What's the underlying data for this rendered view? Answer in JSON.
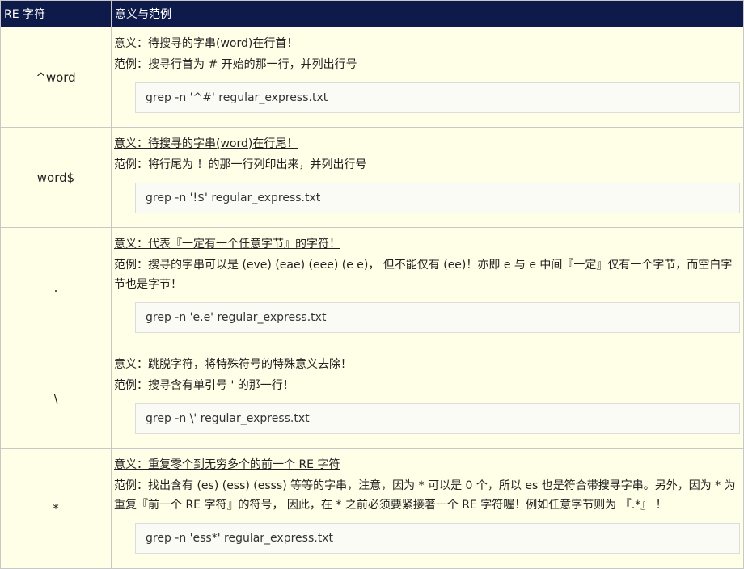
{
  "header": {
    "col_pattern": "RE 字符",
    "col_meaning": "意义与范例"
  },
  "rows": [
    {
      "pattern": "^word",
      "meaning": "意义：待搜寻的字串(word)在行首！",
      "example": "范例：搜寻行首为 # 开始的那一行，并列出行号",
      "code": "grep -n '^#' regular_express.txt"
    },
    {
      "pattern": "word$",
      "meaning": "意义：待搜寻的字串(word)在行尾！",
      "example": "范例：将行尾为 ！的那一行列印出来，并列出行号",
      "code": "grep -n '!$' regular_express.txt"
    },
    {
      "pattern": ".",
      "meaning": "意义：代表『一定有一个任意字节』的字符！",
      "example": "范例：搜寻的字串可以是 (eve) (eae) (eee) (e e)， 但不能仅有 (ee)！亦即 e 与 e 中间『一定』仅有一个字节，而空白字节也是字节！",
      "code": "grep -n 'e.e' regular_express.txt"
    },
    {
      "pattern": "\\",
      "meaning": "意义：跳脱字符，将特殊符号的特殊意义去除！",
      "example": "范例：搜寻含有单引号 ' 的那一行！",
      "code": "grep -n \\' regular_express.txt"
    },
    {
      "pattern": "*",
      "meaning": "意义：重复零个到无穷多个的前一个 RE 字符",
      "example": "范例：找出含有 (es) (ess) (esss) 等等的字串，注意，因为 * 可以是 0 个，所以 es 也是符合带搜寻字串。另外，因为 * 为重复『前一个 RE 字符』的符号， 因此，在 * 之前必须要紧接著一个 RE 字符喔！例如任意字节则为 『.*』 ！",
      "code": "grep -n 'ess*' regular_express.txt"
    }
  ],
  "colors": {
    "header_bg": "#0e1b4a",
    "header_text": "#ffffff",
    "cell_bg": "#fffee6",
    "border": "#c8c8c8"
  }
}
